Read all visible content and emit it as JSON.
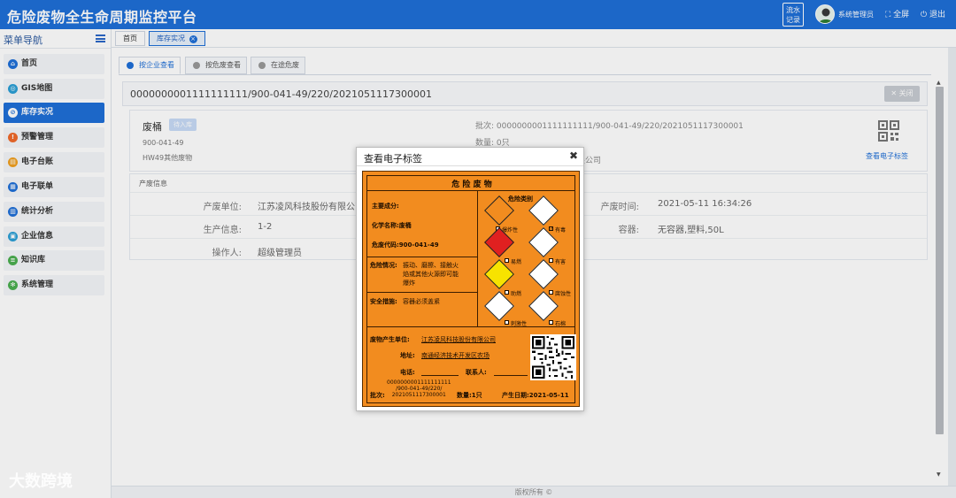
{
  "header": {
    "title": "危险废物全生命周期监控平台",
    "flow_record": [
      "流水",
      "记录"
    ],
    "user_name": "系统管理员",
    "fullscreen": "⛶ 全屏",
    "logout": "⏻ 退出"
  },
  "sidebar": {
    "title": "菜单导航",
    "items": [
      {
        "label": "首页",
        "color": "#1f6fd8"
      },
      {
        "label": "GIS地图",
        "color": "#2a9fd6"
      },
      {
        "label": "库存实况",
        "color": "#ffffff"
      },
      {
        "label": "预警管理",
        "color": "#f06a2a"
      },
      {
        "label": "电子台账",
        "color": "#f0a020"
      },
      {
        "label": "电子联单",
        "color": "#1f6fd8"
      },
      {
        "label": "统计分析",
        "color": "#1f6fd8"
      },
      {
        "label": "企业信息",
        "color": "#2a9fd6"
      },
      {
        "label": "知识库",
        "color": "#4caf50"
      },
      {
        "label": "系统管理",
        "color": "#4caf50"
      }
    ]
  },
  "page_tabs": [
    {
      "label": "首页"
    },
    {
      "label": "库存实况"
    }
  ],
  "sub_tabs": [
    {
      "label": "按企业查看"
    },
    {
      "label": "按危废查看"
    },
    {
      "label": "在途危废"
    }
  ],
  "detail": {
    "batch_full": "0000000001111111111/900-041-49/220/2021051117300001",
    "close_label": "✕ 关闭",
    "waste_name": "废桶",
    "status_badge": "待入库",
    "waste_code": "900-041-49",
    "waste_category": "HW49其他废物",
    "batch_line": "批次:   0000000001111111111/900-041-49/220/2021051117300001",
    "qty_line": "数量:   0只",
    "company_tail": "限公司",
    "qr_link": "查看电子标签"
  },
  "production": {
    "title": "产废信息",
    "rows": [
      {
        "l1": "产废单位:",
        "v1": "江苏凌风科技股份有限公司",
        "l2": "产废时间:",
        "v2": "2021-05-11 16:34:26"
      },
      {
        "l1": "生产信息:",
        "v1": "1-2",
        "l2": "容器:",
        "v2": "无容器,塑料,50L"
      },
      {
        "l1": "操作人:",
        "v1": "超级管理员",
        "l2": "",
        "v2": ""
      }
    ]
  },
  "modal": {
    "title": "查看电子标签",
    "label": {
      "heading": "危 险 废 物",
      "main_component": "主要成分:",
      "chemical_name": "化学名称:废桶",
      "hazard_code": "危废代码:900-041-49",
      "hazard_situation": "危险情况:",
      "hazard_situation_text": [
        "振动、磨擦、接触火",
        "焰或其他火源即可能",
        "爆炸"
      ],
      "safety_label": "安全措施:",
      "safety_text": "容器必须盖紧",
      "category_title": "危险类别",
      "categories": [
        {
          "name": "爆炸性",
          "checked": false,
          "sign": "EXPLOSIVE",
          "color": "#f28c1f"
        },
        {
          "name": "有毒",
          "checked": true,
          "sign": "TOXIC",
          "color": "#ffffff"
        },
        {
          "name": "易燃",
          "checked": false,
          "sign": "FLAMMABLE",
          "color": "#e02020"
        },
        {
          "name": "有害",
          "checked": false,
          "sign": "HARMFUL",
          "color": "#ffffff"
        },
        {
          "name": "助燃",
          "checked": false,
          "sign": "OXIDIZING",
          "color": "#f7e300"
        },
        {
          "name": "腐蚀性",
          "checked": false,
          "sign": "CORROSIVE",
          "color": "#ffffff"
        },
        {
          "name": "刺激性",
          "checked": false,
          "sign": "IRRITANT",
          "color": "#ffffff"
        },
        {
          "name": "石棉",
          "checked": false,
          "sign": "ASBESTOS",
          "color": "#ffffff"
        }
      ],
      "producer": "废物产生单位:",
      "producer_value": "江苏凌风科技股份有限公司",
      "address": "地址:",
      "address_value": "南通经济技术开发区农场",
      "phone": "电话:",
      "contact": "联系人:",
      "batch_label": "批次:",
      "batch_value": [
        "0000000001111111111",
        "/900-041-49/220/",
        "2021051117300001"
      ],
      "quantity": "数量:1只",
      "date": "产生日期:2021-05-11"
    }
  },
  "footer": "版权所有 ©",
  "watermark": "大数跨境"
}
